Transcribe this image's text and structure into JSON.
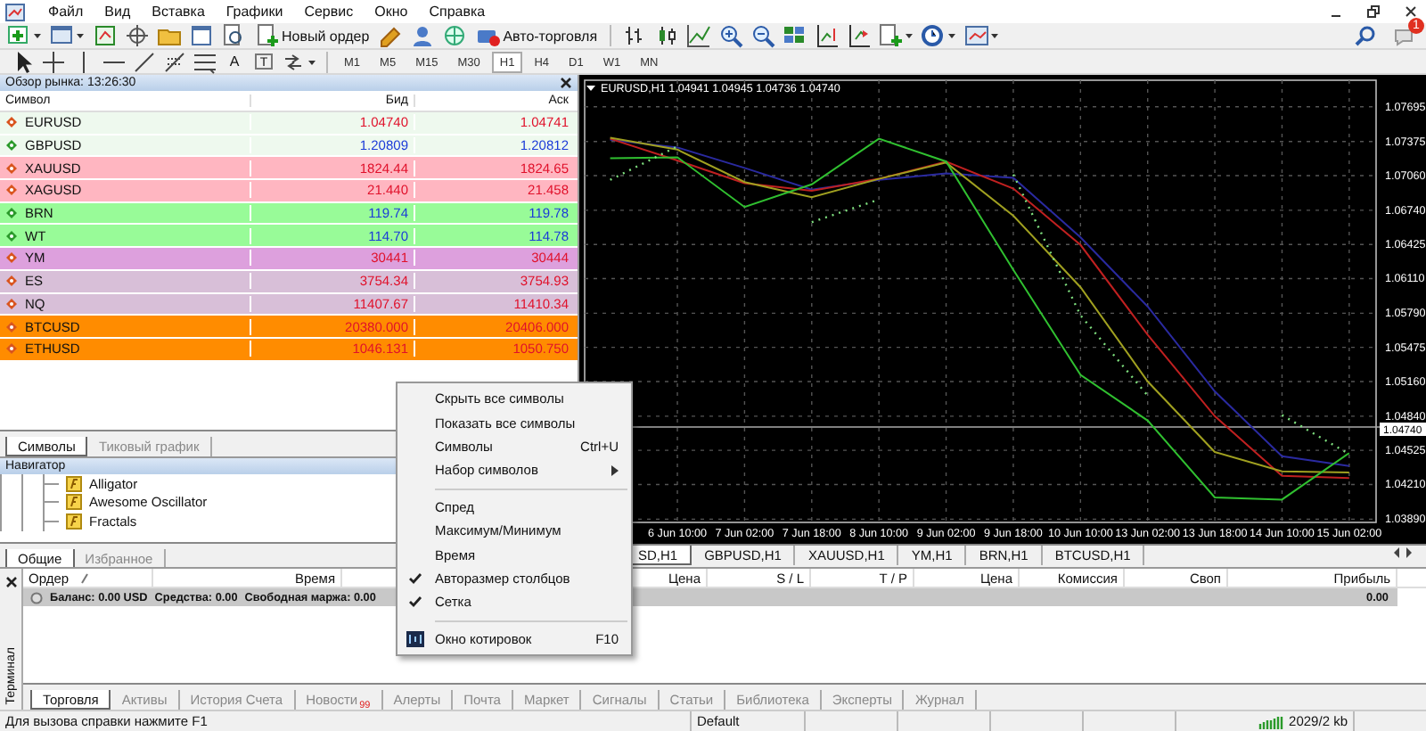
{
  "menu_bar": {
    "items": [
      "Файл",
      "Вид",
      "Вставка",
      "Графики",
      "Сервис",
      "Окно",
      "Справка"
    ]
  },
  "toolbar": {
    "new_order": "Новый ордер",
    "auto_trading": "Авто-торговля",
    "notification_count": "1"
  },
  "drawing_toolbar": {
    "text_tools": [
      "A",
      "T"
    ],
    "timeframes": [
      {
        "label": "M1",
        "selected": false
      },
      {
        "label": "M5",
        "selected": false
      },
      {
        "label": "M15",
        "selected": false
      },
      {
        "label": "M30",
        "selected": false
      },
      {
        "label": "H1",
        "selected": true
      },
      {
        "label": "H4",
        "selected": false
      },
      {
        "label": "D1",
        "selected": false
      },
      {
        "label": "W1",
        "selected": false
      },
      {
        "label": "MN",
        "selected": false
      }
    ]
  },
  "market_watch": {
    "title": "Обзор рынка: 13:26:30",
    "columns": [
      "Символ",
      "Бид",
      "Аск"
    ],
    "rows": [
      {
        "symbol": "EURUSD",
        "bid": "1.04740",
        "ask": "1.04741",
        "rising": false,
        "color": "#eef9ee"
      },
      {
        "symbol": "GBPUSD",
        "bid": "1.20809",
        "ask": "1.20812",
        "rising": true,
        "color": "#eef9ee"
      },
      {
        "symbol": "XAUUSD",
        "bid": "1824.44",
        "ask": "1824.65",
        "rising": false,
        "color": "#ffb6c1"
      },
      {
        "symbol": "XAGUSD",
        "bid": "21.440",
        "ask": "21.458",
        "rising": false,
        "color": "#ffb6c1"
      },
      {
        "symbol": "BRN",
        "bid": "119.74",
        "ask": "119.78",
        "rising": true,
        "color": "#98fb98"
      },
      {
        "symbol": "WT",
        "bid": "114.70",
        "ask": "114.78",
        "rising": true,
        "color": "#98fb98"
      },
      {
        "symbol": "YM",
        "bid": "30441",
        "ask": "30444",
        "rising": false,
        "color": "#dda0dd"
      },
      {
        "symbol": "ES",
        "bid": "3754.34",
        "ask": "3754.93",
        "rising": false,
        "color": "#d8bfd8"
      },
      {
        "symbol": "NQ",
        "bid": "11407.67",
        "ask": "11410.34",
        "rising": false,
        "color": "#d8bfd8"
      },
      {
        "symbol": "BTCUSD",
        "bid": "20380.000",
        "ask": "20406.000",
        "rising": false,
        "color": "#ff8c00"
      },
      {
        "symbol": "ETHUSD",
        "bid": "1046.131",
        "ask": "1050.750",
        "rising": false,
        "color": "#ff8c00"
      }
    ],
    "tabs": [
      {
        "label": "Символы",
        "selected": true
      },
      {
        "label": "Тиковый график",
        "selected": false
      }
    ]
  },
  "navigator": {
    "title": "Навигатор",
    "items": [
      "Alligator",
      "Awesome Oscillator",
      "Fractals"
    ],
    "tabs": [
      {
        "label": "Общие",
        "selected": true
      },
      {
        "label": "Избранное",
        "selected": false
      }
    ]
  },
  "chart": {
    "title": "EURUSD,H1  1.04941 1.04945 1.04736 1.04740",
    "chart_data": {
      "type": "line",
      "ylim": [
        1.0386,
        1.0794
      ],
      "grid": true,
      "ref_lines": [
        {
          "axis": "y",
          "value": 1.0474,
          "label": "1.04740"
        }
      ],
      "categories": [
        null,
        "6 Jun 10:00",
        "7 Jun 02:00",
        "7 Jun 18:00",
        "8 Jun 10:00",
        "9 Jun 02:00",
        "9 Jun 18:00",
        "10 Jun 10:00",
        "13 Jun 02:00",
        "13 Jun 18:00",
        "14 Jun 10:00",
        "15 Jun 02:00"
      ],
      "yticks": [
        {
          "value": 1.07695,
          "label": "1.07695"
        },
        {
          "value": 1.07375,
          "label": "1.07375"
        },
        {
          "value": 1.0706,
          "label": "1.07060"
        },
        {
          "value": 1.0674,
          "label": "1.06740"
        },
        {
          "value": 1.06425,
          "label": "1.06425"
        },
        {
          "value": 1.0611,
          "label": "1.06110"
        },
        {
          "value": 1.0579,
          "label": "1.05790"
        },
        {
          "value": 1.05475,
          "label": "1.05475"
        },
        {
          "value": 1.0516,
          "label": "1.05160"
        },
        {
          "value": 1.0484,
          "label": "1.04840"
        },
        {
          "value": 1.04525,
          "label": "1.04525"
        },
        {
          "value": 1.0421,
          "label": "1.04210"
        },
        {
          "value": 1.0389,
          "label": "1.03890"
        }
      ],
      "series": [
        {
          "color": "#2a2aa0",
          "values": [
            1.0739,
            1.0732,
            1.0713,
            1.0693,
            1.0702,
            1.0708,
            1.0704,
            1.0649,
            1.0585,
            1.0507,
            1.0447,
            1.0438
          ]
        },
        {
          "color": "#c02020",
          "values": [
            1.074,
            1.072,
            1.0699,
            1.0692,
            1.0703,
            1.0719,
            1.0694,
            1.0642,
            1.0559,
            1.0484,
            1.0429,
            1.0427
          ]
        },
        {
          "color": "#a0a020",
          "values": [
            1.0741,
            1.073,
            1.07,
            1.0686,
            1.0703,
            1.0718,
            1.0669,
            1.0603,
            1.0516,
            1.0451,
            1.0433,
            1.0432
          ]
        },
        {
          "color": "#30c030",
          "values": [
            1.0722,
            1.0723,
            1.0677,
            1.0698,
            1.074,
            1.0719,
            1.0619,
            1.0522,
            1.048,
            1.0409,
            1.0407,
            1.045
          ]
        },
        {
          "color": "#7fe07f",
          "line_style": "dotted",
          "values": [
            1.0702,
            1.0733,
            null,
            1.0663,
            1.0684,
            null,
            1.0707,
            1.0577,
            1.0503,
            null,
            1.0485,
            1.0449
          ]
        }
      ]
    }
  },
  "chart_tabs": [
    {
      "label": "SD,H1",
      "selected": true
    },
    {
      "label": "GBPUSD,H1",
      "selected": false
    },
    {
      "label": "XAUUSD,H1",
      "selected": false
    },
    {
      "label": "YM,H1",
      "selected": false
    },
    {
      "label": "BRN,H1",
      "selected": false
    },
    {
      "label": "BTCUSD,H1",
      "selected": false
    }
  ],
  "terminal": {
    "label": "Терминал",
    "columns": [
      "Ордер",
      "Время",
      "Цена",
      "S / L",
      "T / P",
      "Цена",
      "Комиссия",
      "Своп",
      "Прибыль"
    ],
    "balance": [
      "Баланс: 0.00 USD",
      "Средства: 0.00",
      "Свободная маржа: 0.00"
    ],
    "profit": "0.00",
    "tabs": [
      {
        "label": "Торговля",
        "selected": true
      },
      {
        "label": "Активы",
        "selected": false
      },
      {
        "label": "История Счета",
        "selected": false
      },
      {
        "label": "Новости",
        "badge": "99",
        "selected": false
      },
      {
        "label": "Алерты",
        "selected": false
      },
      {
        "label": "Почта",
        "selected": false
      },
      {
        "label": "Маркет",
        "selected": false
      },
      {
        "label": "Сигналы",
        "selected": false
      },
      {
        "label": "Статьи",
        "selected": false
      },
      {
        "label": "Библиотека",
        "selected": false
      },
      {
        "label": "Эксперты",
        "selected": false
      },
      {
        "label": "Журнал",
        "selected": false
      }
    ]
  },
  "context_menu": [
    {
      "kind": "item",
      "label": "Скрыть все символы",
      "checked": false,
      "icon": false,
      "submenu": false
    },
    {
      "kind": "item",
      "label": "Показать все символы",
      "checked": false,
      "icon": false,
      "submenu": false
    },
    {
      "kind": "item",
      "label": "Символы",
      "shortcut": "Ctrl+U",
      "checked": false,
      "icon": false,
      "submenu": false
    },
    {
      "kind": "item",
      "label": "Набор символов",
      "checked": false,
      "icon": false,
      "submenu": true
    },
    {
      "kind": "separator"
    },
    {
      "kind": "item",
      "label": "Спред",
      "checked": false,
      "icon": false,
      "submenu": false
    },
    {
      "kind": "item",
      "label": "Максимум/Минимум",
      "checked": false,
      "icon": false,
      "submenu": false
    },
    {
      "kind": "item",
      "label": "Время",
      "checked": false,
      "icon": false,
      "submenu": false
    },
    {
      "kind": "item",
      "label": "Авторазмер столбцов",
      "checked": true,
      "icon": false,
      "submenu": false
    },
    {
      "kind": "item",
      "label": "Сетка",
      "checked": true,
      "icon": false,
      "submenu": false
    },
    {
      "kind": "separator"
    },
    {
      "kind": "item",
      "label": "Окно котировок",
      "shortcut": "F10",
      "checked": false,
      "icon": true,
      "submenu": false
    }
  ],
  "status_bar": {
    "help": "Для вызова справки нажмите F1",
    "profile": "Default",
    "traffic": "2029/2 kb"
  }
}
